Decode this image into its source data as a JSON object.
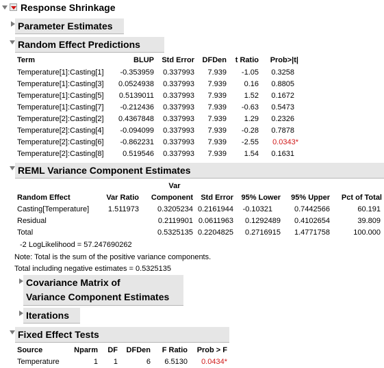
{
  "outline": {
    "response_shrinkage": "Response Shrinkage",
    "parameter_estimates": "Parameter Estimates",
    "random_effect_predictions": "Random Effect Predictions",
    "reml": "REML Variance Component Estimates",
    "covariance_line1": "Covariance Matrix of",
    "covariance_line2": "Variance Component Estimates",
    "iterations": "Iterations",
    "fixed_effect_tests": "Fixed Effect Tests"
  },
  "blup_table": {
    "headers": [
      "Term",
      "BLUP",
      "Std Error",
      "DFDen",
      "t Ratio",
      "Prob>|t|"
    ],
    "rows": [
      {
        "term": "Temperature[1]:Casting[1]",
        "blup": "-0.353959",
        "se": "0.337993",
        "df": "7.939",
        "t": "-1.05",
        "p": "0.3258"
      },
      {
        "term": "Temperature[1]:Casting[3]",
        "blup": "0.0524938",
        "se": "0.337993",
        "df": "7.939",
        "t": "0.16",
        "p": "0.8805"
      },
      {
        "term": "Temperature[1]:Casting[5]",
        "blup": "0.5139011",
        "se": "0.337993",
        "df": "7.939",
        "t": "1.52",
        "p": "0.1672"
      },
      {
        "term": "Temperature[1]:Casting[7]",
        "blup": "-0.212436",
        "se": "0.337993",
        "df": "7.939",
        "t": "-0.63",
        "p": "0.5473"
      },
      {
        "term": "Temperature[2]:Casting[2]",
        "blup": "0.4367848",
        "se": "0.337993",
        "df": "7.939",
        "t": "1.29",
        "p": "0.2326"
      },
      {
        "term": "Temperature[2]:Casting[4]",
        "blup": "-0.094099",
        "se": "0.337993",
        "df": "7.939",
        "t": "-0.28",
        "p": "0.7878"
      },
      {
        "term": "Temperature[2]:Casting[6]",
        "blup": "-0.862231",
        "se": "0.337993",
        "df": "7.939",
        "t": "-2.55",
        "p": "0.0343*"
      },
      {
        "term": "Temperature[2]:Casting[8]",
        "blup": "0.519546",
        "se": "0.337993",
        "df": "7.939",
        "t": "1.54",
        "p": "0.1631"
      }
    ]
  },
  "reml_table": {
    "headers": {
      "random_effect": "Random Effect",
      "var_ratio": "Var Ratio",
      "var_top": "Var",
      "var_bottom": "Component",
      "std_error": "Std Error",
      "lower": "95% Lower",
      "upper": "95% Upper",
      "pct": "Pct of Total"
    },
    "rows": [
      {
        "effect": "Casting[Temperature]",
        "ratio": "1.511973",
        "comp": "0.3205234",
        "se": "0.2161944",
        "lower": "-0.10321",
        "upper": "0.7442566",
        "pct": "60.191"
      },
      {
        "effect": "Residual",
        "ratio": "",
        "comp": "0.2119901",
        "se": "0.0611963",
        "lower": "0.1292489",
        "upper": "0.4102654",
        "pct": "39.809"
      },
      {
        "effect": "Total",
        "ratio": "",
        "comp": "0.5325135",
        "se": "0.2204825",
        "lower": "0.2716915",
        "upper": "1.4771758",
        "pct": "100.000"
      }
    ],
    "loglik": "-2 LogLikelihood =  57.247690262",
    "note": "Note: Total is the sum of the positive variance components.",
    "total_neg": "Total including negative estimates =  0.5325135"
  },
  "fixed_table": {
    "headers": [
      "Source",
      "Nparm",
      "DF",
      "DFDen",
      "F Ratio",
      "Prob > F"
    ],
    "rows": [
      {
        "source": "Temperature",
        "nparm": "1",
        "df": "1",
        "dfden": "6",
        "f": "6.5130",
        "p": "0.0434*"
      }
    ]
  },
  "colors": {
    "header_bg": "#e6e6e6",
    "significant": "#d01a1a",
    "disclosure": "#7a7a7a"
  }
}
